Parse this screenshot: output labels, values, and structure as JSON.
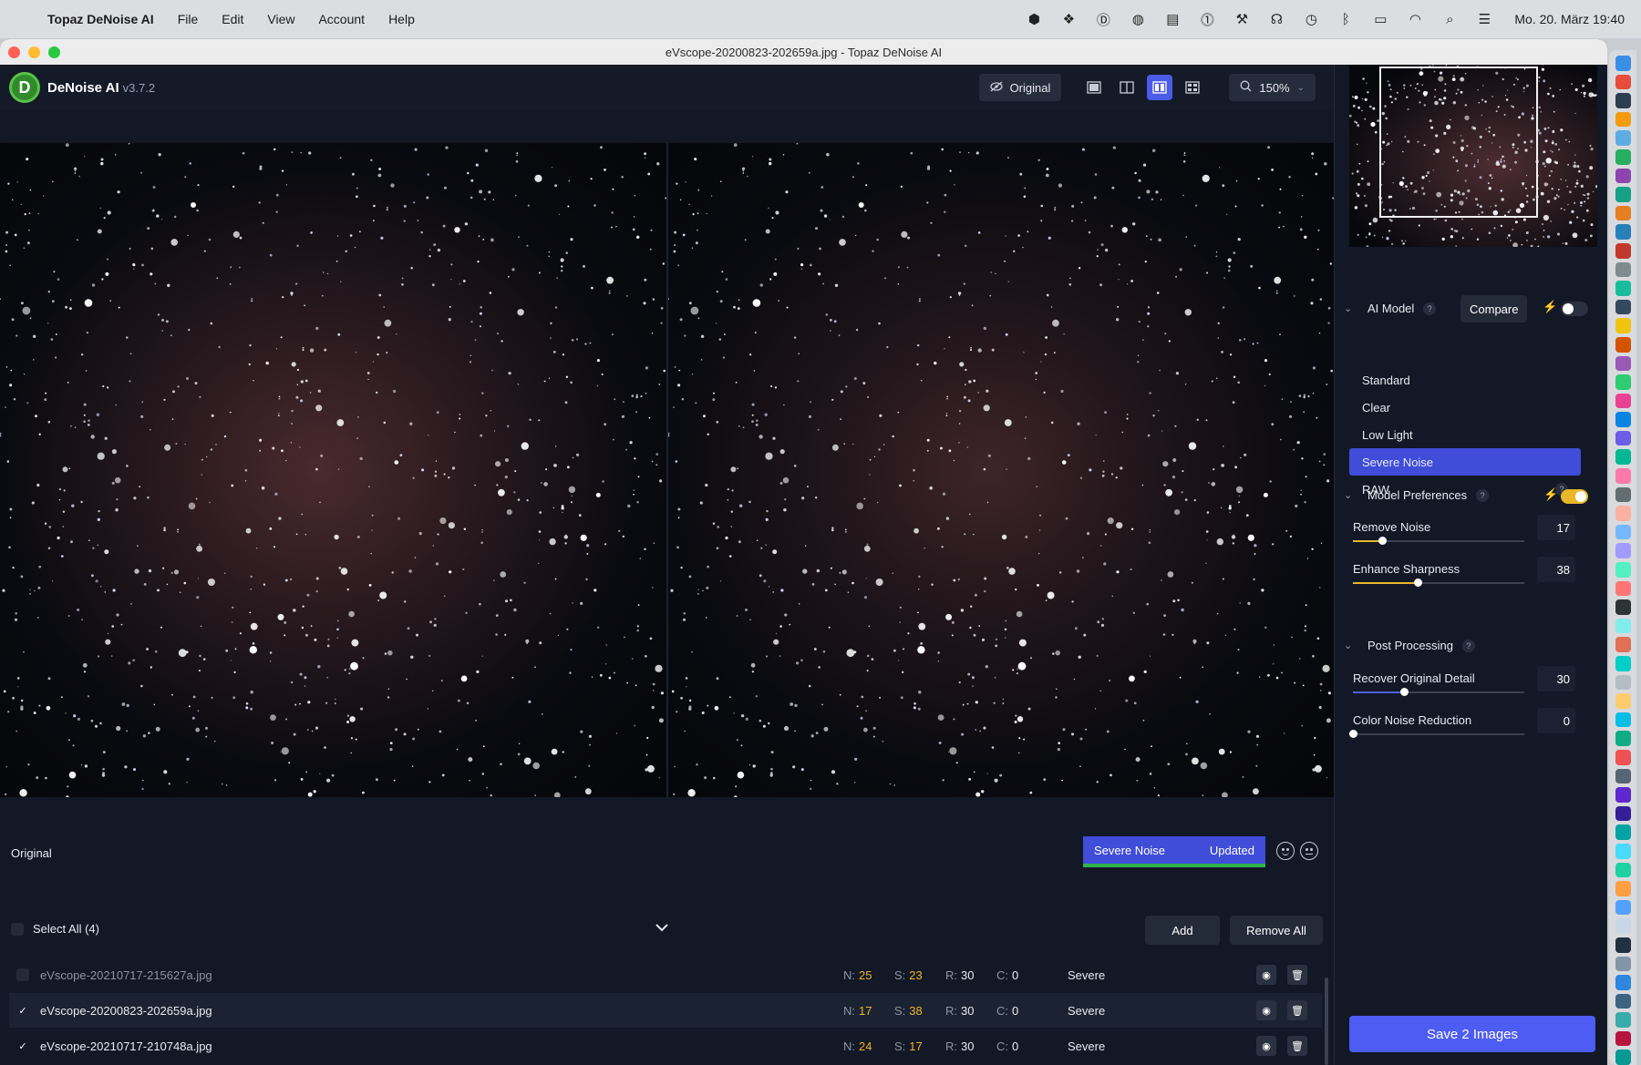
{
  "menubar": {
    "app_name": "Topaz DeNoise AI",
    "items": [
      "File",
      "Edit",
      "View",
      "Account",
      "Help"
    ],
    "clock": "Mo. 20. März  19:40"
  },
  "window": {
    "title": "eVscope-20200823-202659a.jpg - Topaz DeNoise AI"
  },
  "toolbar": {
    "product_name": "DeNoise AI",
    "version": "v3.7.2",
    "original_label": "Original",
    "zoom_label": "150%"
  },
  "preview": {
    "original_caption": "Original",
    "model_chip": "Severe Noise",
    "status_chip": "Updated"
  },
  "filelist": {
    "select_all": "Select All (4)",
    "add_label": "Add",
    "remove_all_label": "Remove All",
    "rows": [
      {
        "name": "eVscope-20210717-215627a.jpg",
        "checked": false,
        "n": "25",
        "s": "23",
        "r": "30",
        "c": "0",
        "model": "Severe"
      },
      {
        "name": "eVscope-20200823-202659a.jpg",
        "checked": true,
        "n": "17",
        "s": "38",
        "r": "30",
        "c": "0",
        "model": "Severe"
      },
      {
        "name": "eVscope-20210717-210748a.jpg",
        "checked": true,
        "n": "24",
        "s": "17",
        "r": "30",
        "c": "0",
        "model": "Severe"
      }
    ],
    "stat_labels": {
      "n": "N:",
      "s": "S:",
      "r": "R:",
      "c": "C:"
    }
  },
  "panel": {
    "ai_model": {
      "title": "AI Model",
      "compare_label": "Compare",
      "models": [
        "Standard",
        "Clear",
        "Low Light",
        "Severe Noise",
        "RAW"
      ],
      "selected": "Severe Noise"
    },
    "prefs": {
      "title": "Model Preferences",
      "remove_noise": {
        "label": "Remove Noise",
        "value": "17",
        "fraction": 0.17
      },
      "enhance_sharpness": {
        "label": "Enhance Sharpness",
        "value": "38",
        "fraction": 0.38
      }
    },
    "post": {
      "title": "Post Processing",
      "recover_detail": {
        "label": "Recover Original Detail",
        "value": "30",
        "fraction": 0.3
      },
      "color_noise": {
        "label": "Color Noise Reduction",
        "value": "0",
        "fraction": 0.0
      }
    },
    "save_label": "Save 2 Images",
    "qmark": "?"
  },
  "colors": {
    "accent": "#4d5cf2",
    "active_model": "#3f4dd8",
    "toggle_on": "#e8b82a",
    "stat_highlight": "#f0b429"
  }
}
